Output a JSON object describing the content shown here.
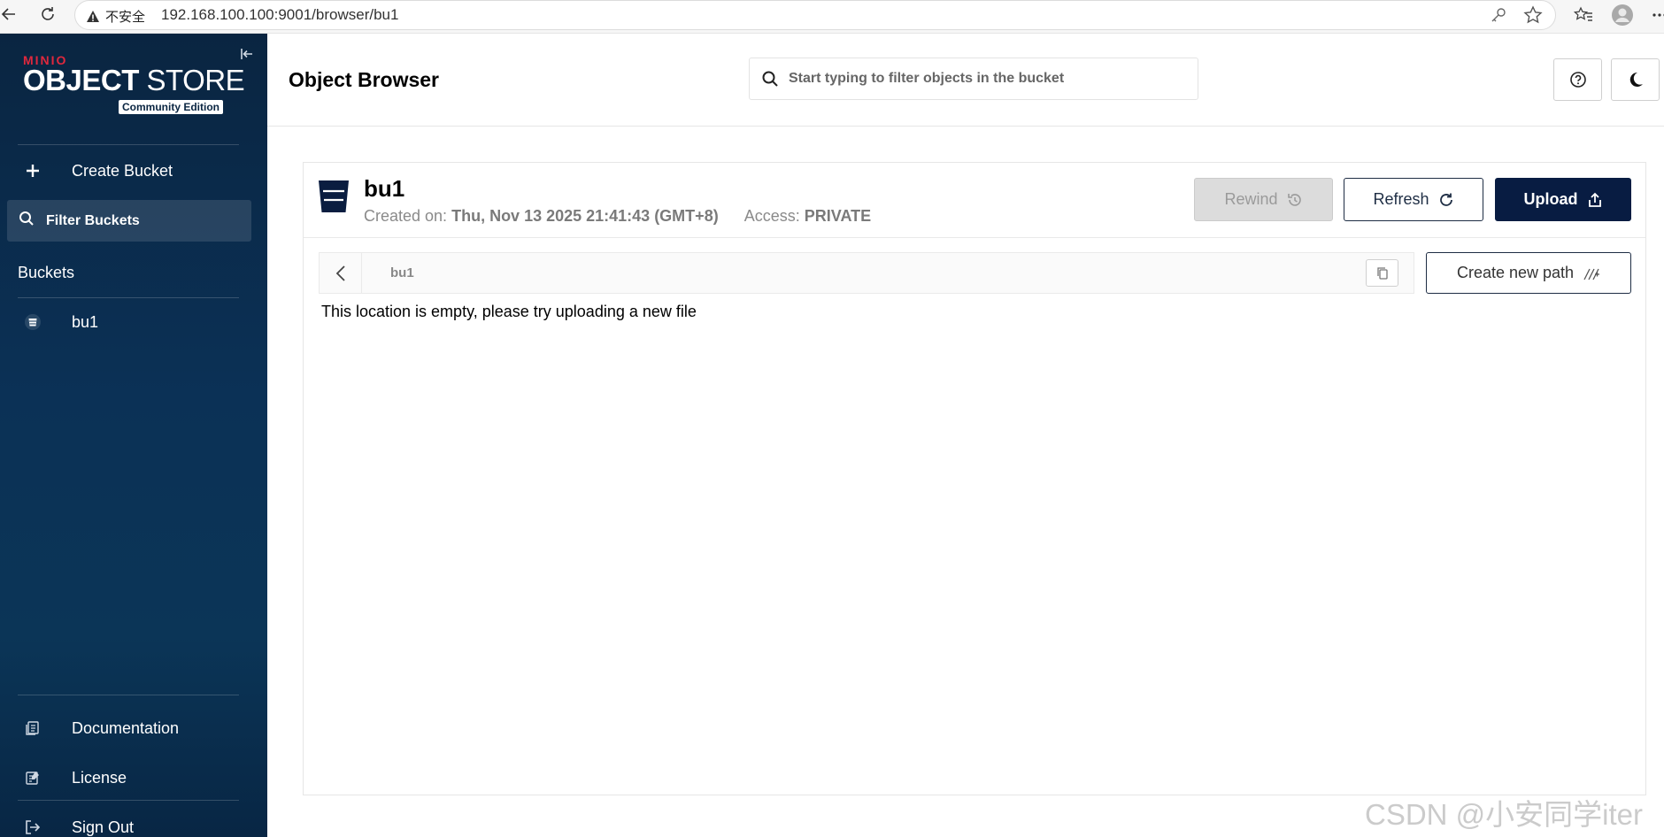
{
  "browser": {
    "security_label": "不安全",
    "url": "192.168.100.100:9001/browser/bu1"
  },
  "sidebar": {
    "logo_brand": "MINIO",
    "logo_title_bold": "OBJECT",
    "logo_title_light": " STORE",
    "logo_edition": "Community Edition",
    "create_bucket_label": "Create Bucket",
    "filter_buckets_label": "Filter Buckets",
    "buckets_heading": "Buckets",
    "buckets": [
      {
        "name": "bu1"
      }
    ],
    "documentation_label": "Documentation",
    "license_label": "License",
    "sign_out_label": "Sign Out"
  },
  "header": {
    "title": "Object Browser",
    "search_placeholder": "Start typing to filter objects in the bucket"
  },
  "bucket": {
    "name": "bu1",
    "created_label": "Created on:",
    "created_value": "Thu, Nov 13 2025 21:41:43 (GMT+8)",
    "access_label": "Access:",
    "access_value": "PRIVATE",
    "rewind_label": "Rewind",
    "refresh_label": "Refresh",
    "upload_label": "Upload",
    "breadcrumb_path": "bu1",
    "create_path_label": "Create new path",
    "empty_message": "This location is empty, please try uploading a new file"
  },
  "watermark": "CSDN @小安同学iter",
  "colors": {
    "sidebar_bg": "#0b3156",
    "primary_button": "#081c42",
    "brand_red": "#e0283d"
  }
}
